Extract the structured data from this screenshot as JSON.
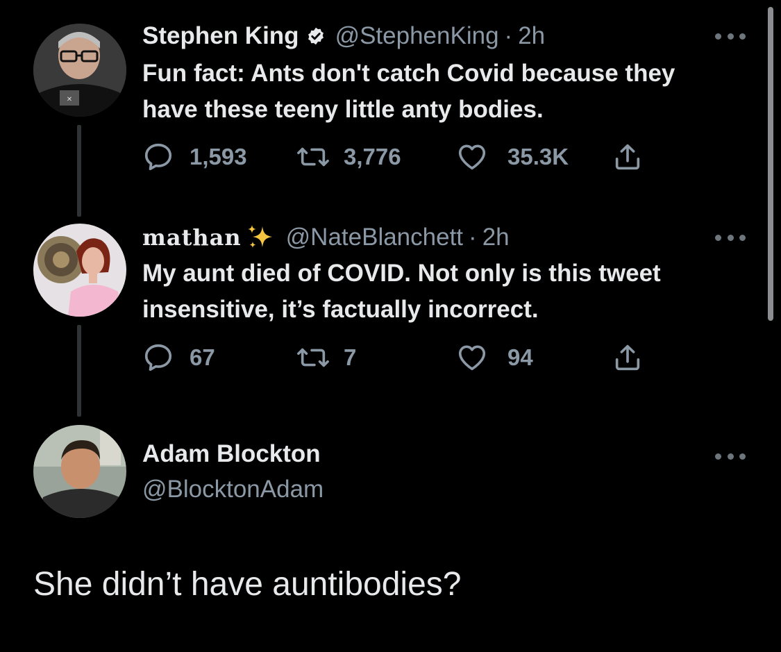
{
  "tweets": [
    {
      "display_name": "Stephen King",
      "verified": true,
      "handle": "@StephenKing",
      "separator": "·",
      "time": "2h",
      "text": "Fun fact: Ants don't catch Covid because they\nhave these teeny little anty bodies.",
      "replies": "1,593",
      "retweets": "3,776",
      "likes": "35.3K",
      "avatar_icon": "man-with-glasses-photo"
    },
    {
      "display_name": "mathan",
      "name_emoji": "sparkles-icon",
      "handle": "@NateBlanchett",
      "separator": "·",
      "time": "2h",
      "text": "My aunt died of COVID. Not only is this tweet\ninsensitive, it’s factually incorrect.",
      "replies": "67",
      "retweets": "7",
      "likes": "94",
      "avatar_icon": "woman-in-pink-photo"
    }
  ],
  "focused_tweet": {
    "display_name": "Adam Blockton",
    "handle": "@BlocktonAdam",
    "text": "She didn’t have auntibodies?",
    "avatar_icon": "man-portrait-photo"
  },
  "colors": {
    "background": "#000000",
    "primary_text": "#e7e9ea",
    "secondary_text": "#8b98a5",
    "thread_line": "#2f3336",
    "sparkle": "#f5c542"
  }
}
